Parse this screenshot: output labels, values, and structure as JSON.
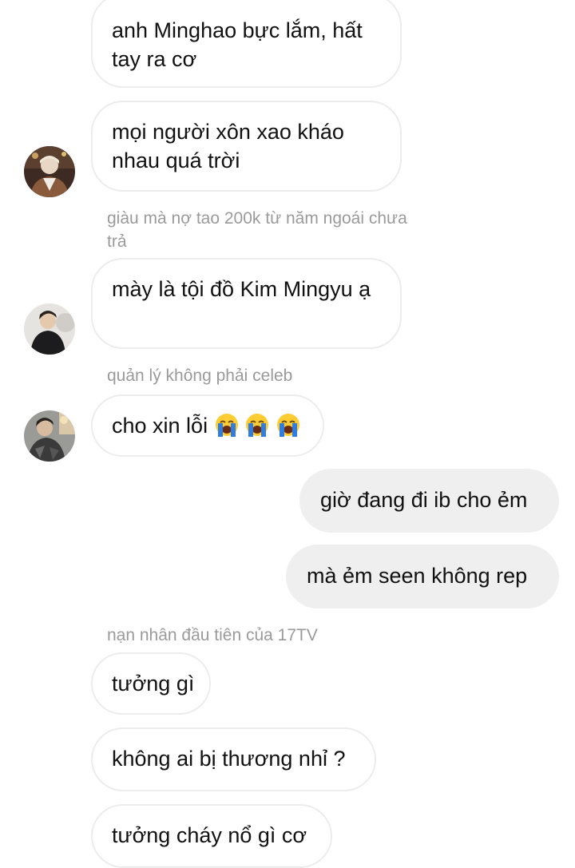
{
  "messages": [
    {
      "text": "anh Minghao bực lắm, hất tay ra cơ"
    },
    {
      "text": "mọi người xôn xao kháo nhau quá trời"
    },
    {
      "sender": "giàu mà nợ tao 200k từ năm ngoái chưa trả",
      "text": "mày là tội đồ Kim Mingyu ạ"
    },
    {
      "sender": "quản lý không phải celeb",
      "text": "cho xin lỗi",
      "emoji": [
        "loudly-crying-face",
        "loudly-crying-face",
        "loudly-crying-face"
      ]
    },
    {
      "text": "giờ đang đi ib cho ẻm"
    },
    {
      "text": "mà ẻm seen không rep"
    },
    {
      "sender": "nạn nhân đầu tiên của 17TV",
      "text": "tưởng gì"
    },
    {
      "text": "không ai bị thương nhỉ ?"
    },
    {
      "text": "tưởng cháy nổ gì cơ"
    }
  ],
  "avatars": [
    "user-avatar-1",
    "user-avatar-2",
    "user-avatar-3"
  ],
  "colors": {
    "incoming_border": "#ececec",
    "outgoing_bg": "#efefef",
    "sender_text": "#9a9a9a",
    "emoji_face": "#ffcc33",
    "emoji_tears": "#2f7de1"
  }
}
